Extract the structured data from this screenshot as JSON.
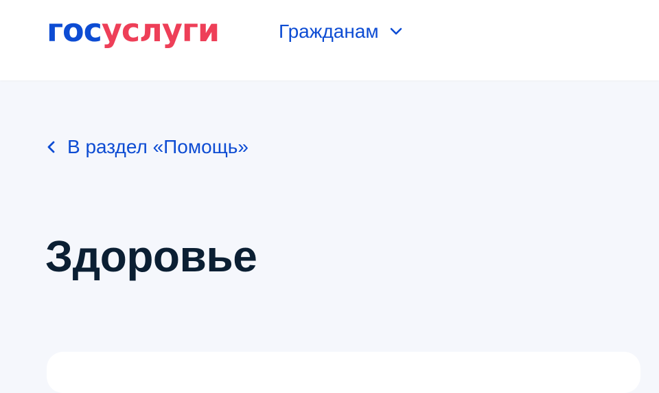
{
  "header": {
    "logo": {
      "part1": "гос",
      "part2": "услуги"
    },
    "nav_label": "Гражданам",
    "nav_icon": "chevron-down-icon"
  },
  "breadcrumb": {
    "icon": "chevron-left-icon",
    "label": "В раздел «Помощь»"
  },
  "main": {
    "title": "Здоровье"
  },
  "colors": {
    "brand_blue": "#0d4cd3",
    "brand_red": "#ee3f58",
    "title_text": "#0b1f33",
    "page_bg": "#f5f7fc",
    "header_bg": "#ffffff"
  }
}
